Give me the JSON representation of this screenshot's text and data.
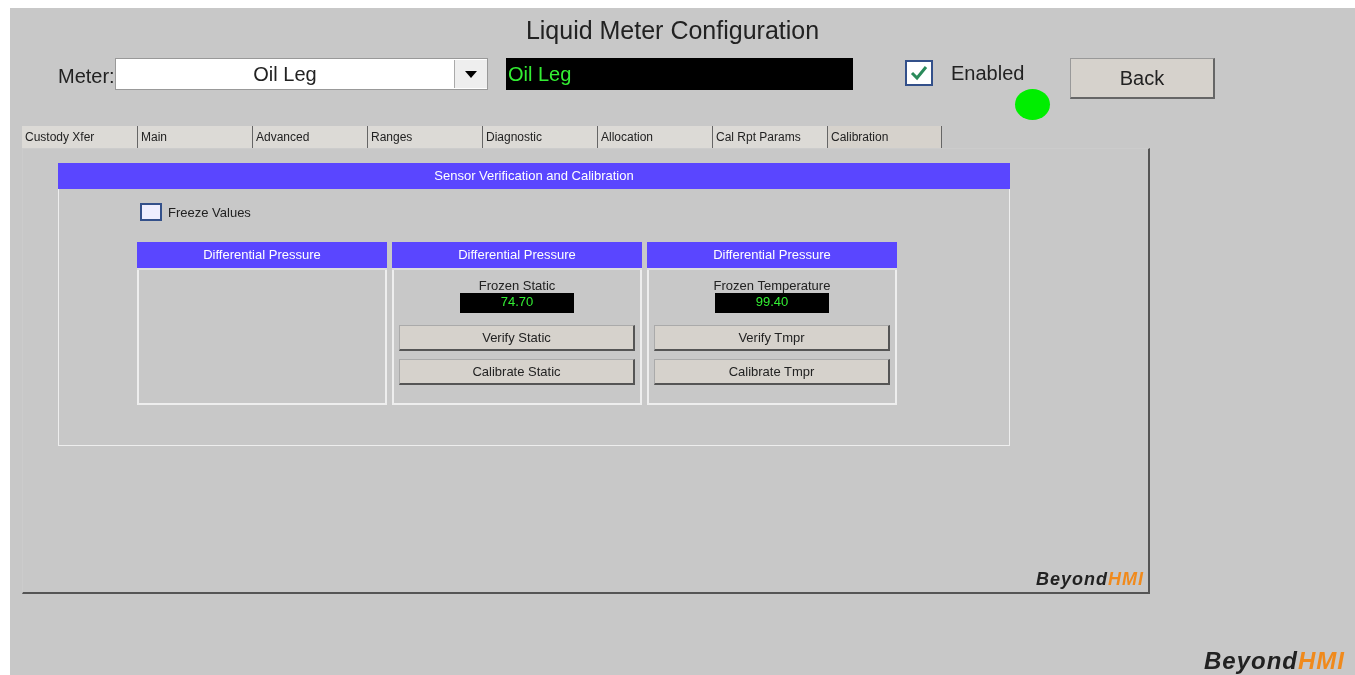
{
  "window": {
    "title": "Liquid Meter Configuration"
  },
  "meter": {
    "label": "Meter:",
    "value": "Oil Leg",
    "display": "Oil Leg"
  },
  "enabled": {
    "label": "Enabled",
    "checked": true
  },
  "status": {
    "color": "#00ee00"
  },
  "back_button": "Back",
  "tabs": [
    {
      "label": "Custody Xfer",
      "selected": false
    },
    {
      "label": "Main",
      "selected": false
    },
    {
      "label": "Advanced",
      "selected": false
    },
    {
      "label": "Ranges",
      "selected": false
    },
    {
      "label": "Diagnostic",
      "selected": false
    },
    {
      "label": "Allocation",
      "selected": false
    },
    {
      "label": "Cal Rpt Params",
      "selected": false
    },
    {
      "label": "Calibration",
      "selected": true
    }
  ],
  "section": {
    "title": "Sensor Verification and Calibration",
    "freeze": {
      "label": "Freeze Values",
      "checked": false
    },
    "cards": [
      {
        "title": "Differential Pressure"
      },
      {
        "title": "Differential Pressure",
        "reading_label": "Frozen Static",
        "reading": "74.70",
        "buttons": [
          "Verify Static",
          "Calibrate Static"
        ]
      },
      {
        "title": "Differential Pressure",
        "reading_label": "Frozen Temperature",
        "reading": "99.40",
        "buttons": [
          "Verify Tmpr",
          "Calibrate Tmpr"
        ]
      }
    ]
  },
  "panel_logo": {
    "part_1": "Beyond",
    "part_2": "HMI"
  },
  "footer_logo": {
    "part_1": "Beyond",
    "part_2": "HMI"
  }
}
